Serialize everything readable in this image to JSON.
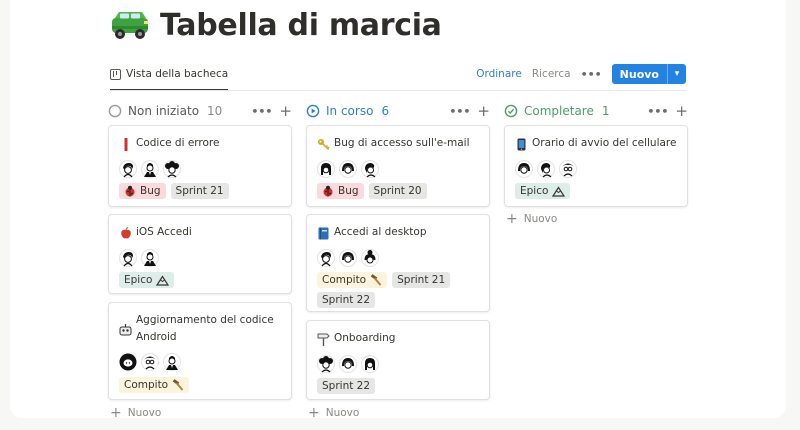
{
  "page": {
    "title": "Tabella di marcia",
    "title_icon": "green-car-icon"
  },
  "toolbar": {
    "view_tab": "Vista della bacheca",
    "sort": "Ordinare",
    "search": "Ricerca",
    "more": "•••",
    "new_button": "Nuovo"
  },
  "columns": [
    {
      "name": "Non iniziato",
      "count": "10",
      "status_icon": "empty-circle-icon",
      "cards": [
        {
          "title": "Codice di errore",
          "icon": "red-bar-icon",
          "tags": [
            "Bug",
            "Sprint 21"
          ]
        },
        {
          "title": "iOS Accedi",
          "icon": "apple-icon",
          "tags": [
            "Epico"
          ]
        },
        {
          "title": "Aggiornamento del codice Android",
          "icon": "robot-icon",
          "tags": [
            "Compito"
          ]
        }
      ],
      "new_label": "Nuovo"
    },
    {
      "name": "In corso",
      "count": "6",
      "status_icon": "play-circle-icon",
      "cards": [
        {
          "title": "Bug di accesso sull'e-mail",
          "icon": "key-icon",
          "tags": [
            "Bug",
            "Sprint 20"
          ]
        },
        {
          "title": "Accedi al desktop",
          "icon": "book-icon",
          "tags": [
            "Compito",
            "Sprint 21",
            "Sprint 22"
          ]
        },
        {
          "title": "Onboarding",
          "icon": "signpost-icon",
          "tags": [
            "Sprint 22"
          ]
        }
      ],
      "new_label": "Nuovo"
    },
    {
      "name": "Completare",
      "count": "1",
      "status_icon": "check-circle-icon",
      "cards": [
        {
          "title": "Orario di avvio del cellulare",
          "icon": "phone-icon",
          "tags": [
            "Epico"
          ]
        }
      ],
      "new_label": "Nuovo"
    }
  ],
  "colors": {
    "accent": "#2383e2",
    "bug_tag": "#fadadd",
    "sprint_tag": "#e6e6e4",
    "epico_tag": "#ddedea",
    "compito_tag": "#fbf3db",
    "play_icon": "#2f80d0",
    "check_icon": "#4a9e6b"
  }
}
